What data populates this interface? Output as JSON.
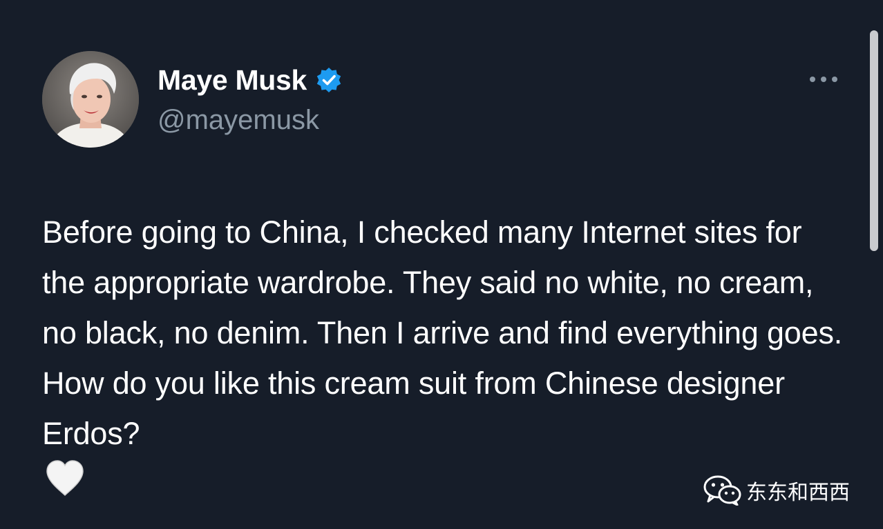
{
  "author": {
    "display_name": "Maye Musk",
    "handle": "@mayemusk",
    "verified": true,
    "avatar_icon": "profile-photo"
  },
  "tweet": {
    "text": "Before going to China, I checked many Internet sites for the appropriate wardrobe. They said no white, no cream, no black, no denim. Then I arrive and find everything goes. How do you like this cream suit from Chinese designer Erdos?",
    "emoji": "🤍"
  },
  "icons": {
    "verified": "verified-badge-icon",
    "more": "more-options-icon",
    "wechat": "wechat-icon"
  },
  "watermark": {
    "text": "东东和西西"
  },
  "colors": {
    "background": "#161d29",
    "primary_text": "#ffffff",
    "secondary_text": "#8b98a5",
    "verified_blue": "#1d9bf0"
  }
}
